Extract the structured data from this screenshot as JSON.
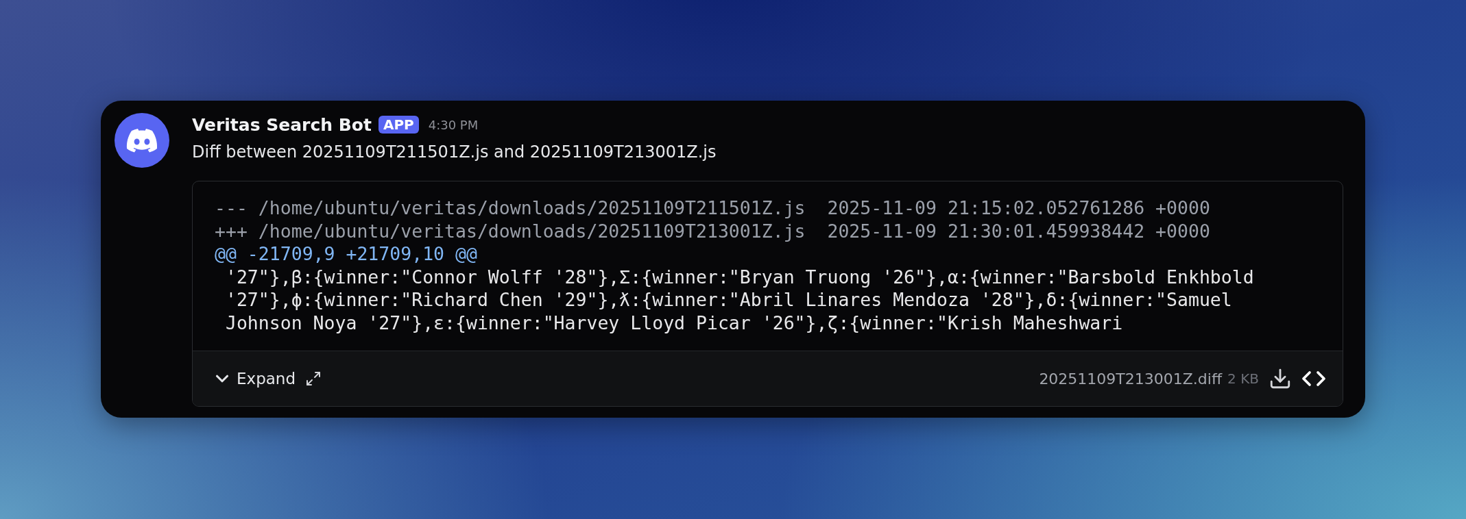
{
  "message": {
    "author": "Veritas Search Bot",
    "badge": "APP",
    "time": "4:30 PM",
    "text": "Diff between 20251109T211501Z.js and 20251109T213001Z.js"
  },
  "attachment": {
    "lines": [
      {
        "kind": "header",
        "text": "--- /home/ubuntu/veritas/downloads/20251109T211501Z.js  2025-11-09 21:15:02.052761286 +0000"
      },
      {
        "kind": "header",
        "text": "+++ /home/ubuntu/veritas/downloads/20251109T213001Z.js  2025-11-09 21:30:01.459938442 +0000"
      },
      {
        "kind": "hunk",
        "text": "@@ -21709,9 +21709,10 @@"
      },
      {
        "kind": "context",
        "text": " '27\"},β:{winner:\"Connor Wolff '28\"},Σ:{winner:\"Bryan Truong '26\"},α:{winner:\"Barsbold Enkhbold"
      },
      {
        "kind": "context",
        "text": " '27\"},ϕ:{winner:\"Richard Chen '29\"},ƛ:{winner:\"Abril Linares Mendoza '28\"},δ:{winner:\"Samuel"
      },
      {
        "kind": "context",
        "text": " Johnson Noya '27\"},ε:{winner:\"Harvey Lloyd Picar '26\"},ζ:{winner:\"Krish Maheshwari"
      }
    ],
    "expand_label": "Expand",
    "filename": "20251109T213001Z.diff",
    "size": "2 KB"
  }
}
